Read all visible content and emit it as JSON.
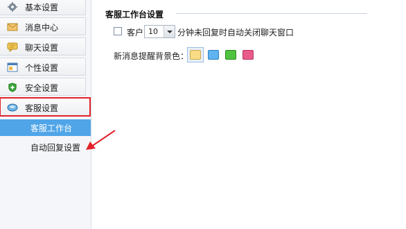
{
  "sidebar": {
    "items": [
      {
        "label": "基本设置",
        "icon": "gear-icon"
      },
      {
        "label": "消息中心",
        "icon": "envelope-icon"
      },
      {
        "label": "聊天设置",
        "icon": "chat-bubble-icon"
      },
      {
        "label": "个性设置",
        "icon": "window-icon"
      },
      {
        "label": "安全设置",
        "icon": "shield-icon"
      },
      {
        "label": "客服设置",
        "icon": "customer-service-icon"
      }
    ],
    "sub_items": [
      {
        "label": "客服工作台",
        "selected": true
      },
      {
        "label": "自动回复设置",
        "selected": false
      }
    ]
  },
  "main": {
    "section_title": "客服工作台设置",
    "close_option": {
      "prefix": "客户",
      "minutes_value": "10",
      "suffix": "分钟未回复时自动关闭聊天窗口",
      "checked": false
    },
    "bg_color": {
      "label": "新消息提醒背景色：",
      "swatches": [
        "#f9dc85",
        "#5fb3ef",
        "#4fc23f",
        "#ea5a8a"
      ],
      "selected_index": 0
    }
  },
  "colors": {
    "highlight_box": "#e3212b",
    "selected_bg": "#4fa5e8"
  }
}
